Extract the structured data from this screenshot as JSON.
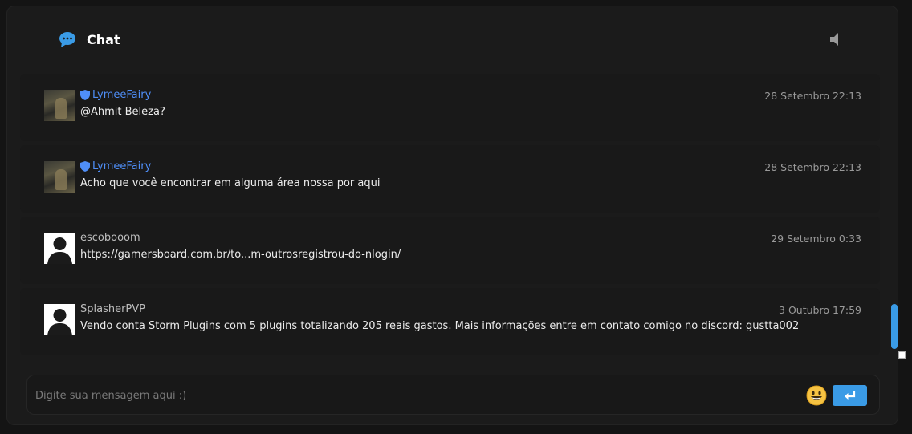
{
  "header": {
    "title": "Chat",
    "chat_icon": "chat-bubble-icon",
    "sound_icon": "speaker-icon"
  },
  "messages": [
    {
      "author": "LymeeFairy",
      "moderator": true,
      "avatar": "photo",
      "time": "28 Setembro 22:13",
      "text": "@Ahmit Beleza?"
    },
    {
      "author": "LymeeFairy",
      "moderator": true,
      "avatar": "photo",
      "time": "28 Setembro 22:13",
      "text": "Acho que você encontrar em alguma área nossa por aqui"
    },
    {
      "author": "escobooom",
      "moderator": false,
      "avatar": "default",
      "time": "29 Setembro 0:33",
      "text": "https://gamersboard.com.br/to...m-outrosregistrou-do-nlogin/"
    },
    {
      "author": "SplasherPVP",
      "moderator": false,
      "avatar": "default",
      "time": "3 Outubro 17:59",
      "text": "Vendo conta Storm Plugins com 5 plugins totalizando 205 reais gastos. Mais informações entre em contato comigo no discord: gustta002"
    }
  ],
  "composer": {
    "placeholder": "Digite sua mensagem aqui :)",
    "value": "",
    "emoji_icon": "smiley-icon",
    "send_icon": "enter-arrow-icon"
  },
  "colors": {
    "accent": "#3a9be6",
    "moderator_name": "#4f8ef7",
    "background": "#1b1b1b"
  }
}
